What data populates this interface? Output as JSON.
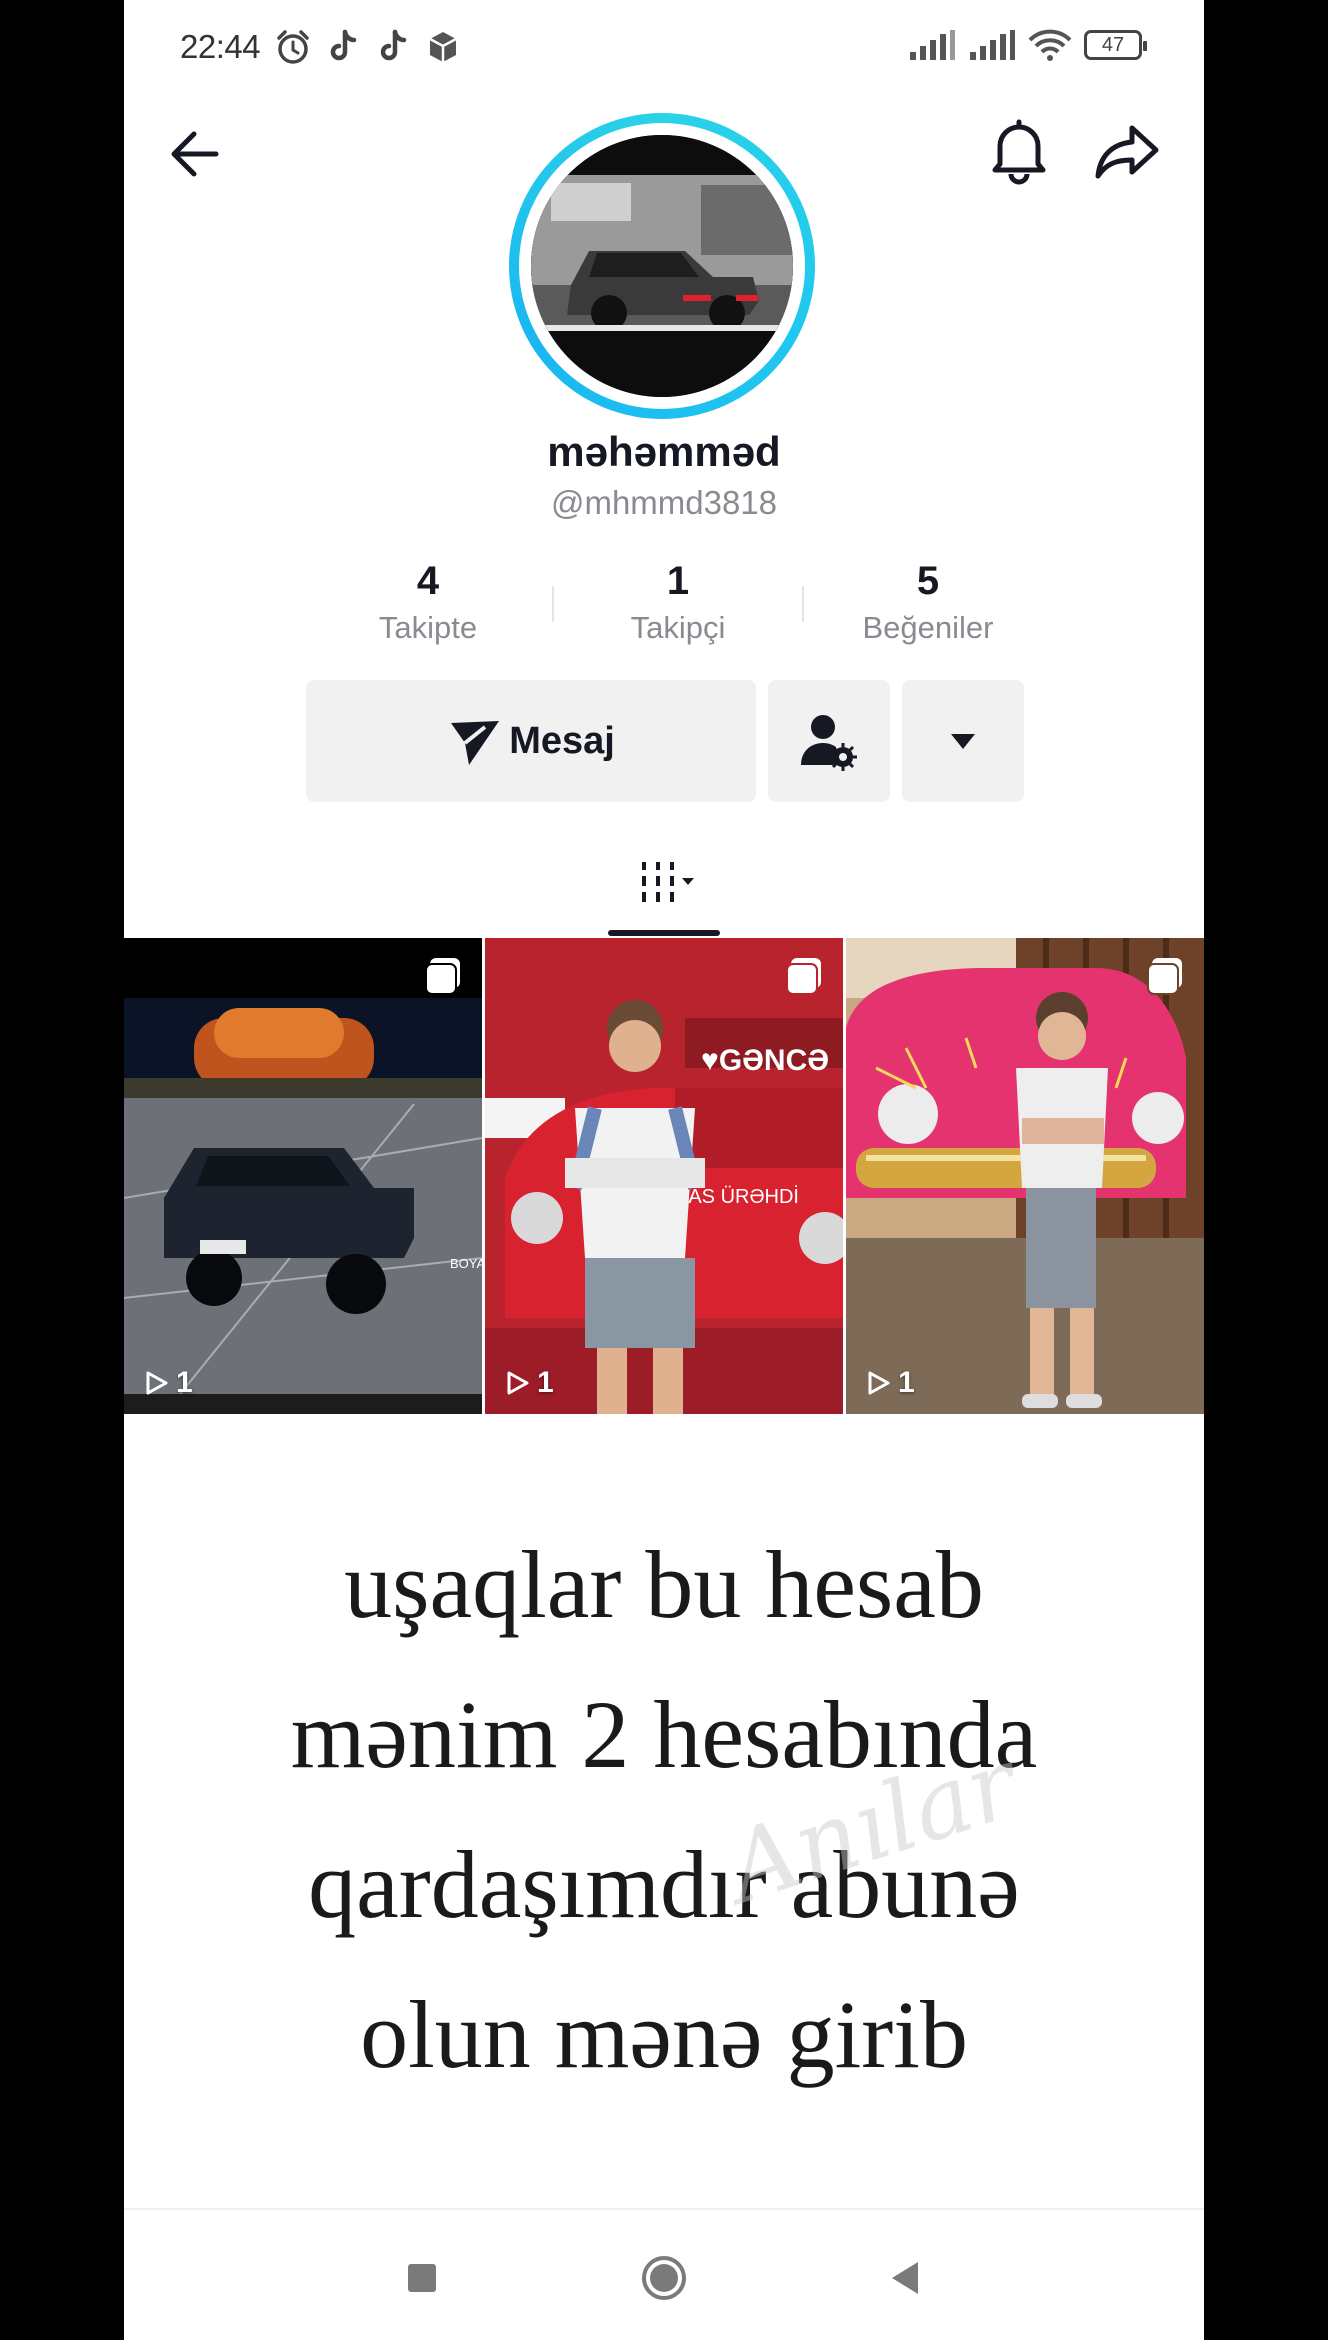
{
  "status_bar": {
    "time": "22:44",
    "battery": "47",
    "icons": [
      "alarm-icon",
      "tiktok-icon",
      "tiktok-icon",
      "box-icon",
      "signal-icon",
      "signal-icon",
      "wifi-icon",
      "battery-icon"
    ]
  },
  "header": {
    "back_icon": "arrow-left-icon",
    "bell_icon": "bell-icon",
    "share_icon": "share-arrow-icon"
  },
  "profile": {
    "display_name": "məhəmməd",
    "username": "@mhmmd3818"
  },
  "stats": [
    {
      "value": "4",
      "label": "Takipte"
    },
    {
      "value": "1",
      "label": "Takipçi"
    },
    {
      "value": "5",
      "label": "Beğeniler"
    }
  ],
  "actions": {
    "message_label": "Mesaj",
    "message_icon": "send-icon",
    "friend_icon": "user-settings-icon",
    "more_icon": "caret-down-icon"
  },
  "videos": [
    {
      "views": "1",
      "badge_icon": "multi-photo-icon",
      "subject": "dark sedan at night"
    },
    {
      "views": "1",
      "badge_icon": "multi-photo-icon",
      "subject": "boy with red car"
    },
    {
      "views": "1",
      "badge_icon": "multi-photo-icon",
      "subject": "boy with pink classic car"
    }
  ],
  "thumb_texts": {
    "ganca": "♥GƏNCƏ",
    "plate": "SAS ÜRƏHDİ",
    "shop": "BOYA"
  },
  "caption": {
    "lines": [
      "uşaqlar bu hesab",
      "mənim 2 hesabında",
      "qardaşımdır abunə",
      "olun mənə girib"
    ],
    "watermark": "Anılar"
  },
  "colors": {
    "ring": "#20c7ef",
    "text": "#161823",
    "secondary": "#8a8b91",
    "button_bg": "#f1f1f2"
  }
}
